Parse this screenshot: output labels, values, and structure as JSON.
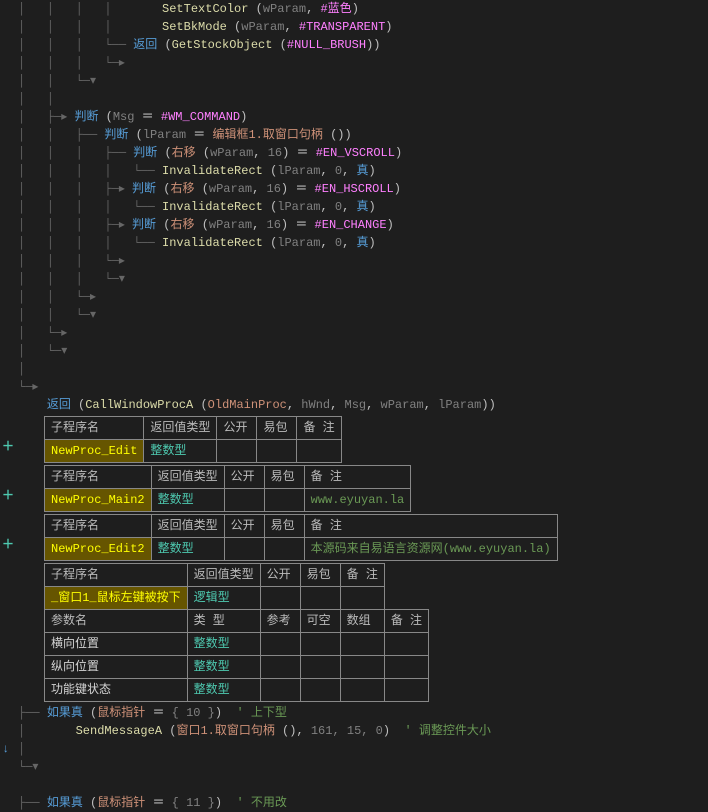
{
  "code": {
    "l1a": "SetTextColor",
    "l1b": "wParam",
    "l1c": "#蓝色",
    "l2a": "SetBkMode",
    "l2b": "wParam",
    "l2c": "#TRANSPARENT",
    "l3a": "返回",
    "l3b": "GetStockObject",
    "l3c": "#NULL_BRUSH",
    "l4a": "判断",
    "l4b": "Msg",
    "l4c": "#WM_COMMAND",
    "l5a": "判断",
    "l5b": "lParam",
    "l5c": "编辑框1.取窗口句柄",
    "l6a": "判断",
    "l6b": "右移",
    "l6c": "wParam",
    "l6d": "16",
    "l6e": "#EN_VSCROLL",
    "l7a": "InvalidateRect",
    "l7b": "lParam",
    "l7c": "0",
    "l7d": "真",
    "l8a": "判断",
    "l8b": "右移",
    "l8c": "wParam",
    "l8d": "16",
    "l8e": "#EN_HSCROLL",
    "l9a": "InvalidateRect",
    "l9b": "lParam",
    "l9c": "0",
    "l9d": "真",
    "l10a": "判断",
    "l10b": "右移",
    "l10c": "wParam",
    "l10d": "16",
    "l10e": "#EN_CHANGE",
    "l11a": "InvalidateRect",
    "l11b": "lParam",
    "l11c": "0",
    "l11d": "真",
    "ret_a": "返回",
    "ret_b": "CallWindowProcA",
    "ret_c": "OldMainProc",
    "ret_d": "hWnd",
    "ret_e": "Msg",
    "ret_f": "wParam",
    "ret_g": "lParam"
  },
  "headers": {
    "subname": "子程序名",
    "rettype": "返回值类型",
    "public": "公开",
    "yibao": "易包",
    "note": "备 注",
    "paramname": "参数名",
    "type": "类 型",
    "ref": "参考",
    "opt": "可空",
    "arr": "数组"
  },
  "t1": {
    "name": "NewProc_Edit",
    "type": "整数型"
  },
  "t2": {
    "name": "NewProc_Main2",
    "type": "整数型",
    "note": "www.eyuyan.la"
  },
  "t3": {
    "name": "NewProc_Edit2",
    "type": "整数型",
    "note": "本源码来自易语言资源网(www.eyuyan.la)"
  },
  "t4": {
    "name": "_窗口1_鼠标左键被按下",
    "type": "逻辑型",
    "p1": {
      "name": "横向位置",
      "type": "整数型"
    },
    "p2": {
      "name": "纵向位置",
      "type": "整数型"
    },
    "p3": {
      "name": "功能键状态",
      "type": "整数型"
    }
  },
  "tail": {
    "a1": "如果真",
    "a2": "鼠标指针",
    "a3": "{ 10 }",
    "a4": "' 上下型",
    "b1": "SendMessageA",
    "b2": "窗口1.取窗口句柄",
    "b3": "161, 15, 0",
    "b4": "' 调整控件大小",
    "c1": "如果真",
    "c2": "鼠标指针",
    "c3": "{ 11 }",
    "c4": "' 不用改"
  }
}
